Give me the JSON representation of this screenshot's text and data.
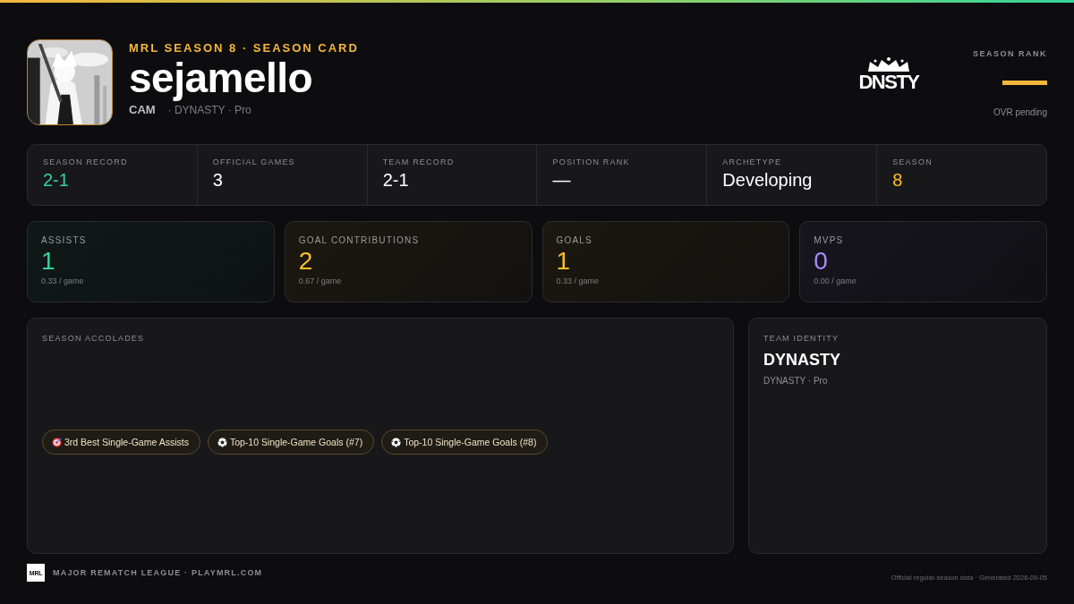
{
  "header": {
    "eyebrow": "MRL SEASON 8 · SEASON CARD",
    "player": "sejamello",
    "position": "CAM",
    "team_line": "· DYNASTY · Pro",
    "team_logo_text": "DNSTY",
    "rank_label": "SEASON RANK",
    "rank_note": "OVR pending"
  },
  "summary": [
    {
      "label": "SEASON RECORD",
      "value": "2-1",
      "color": "#34d399"
    },
    {
      "label": "OFFICIAL GAMES",
      "value": "3",
      "color": "#ffffff"
    },
    {
      "label": "TEAM RECORD",
      "value": "2-1",
      "color": "#ffffff"
    },
    {
      "label": "POSITION RANK",
      "value": "—",
      "color": "#ffffff"
    },
    {
      "label": "ARCHETYPE",
      "value": "Developing",
      "color": "#ffffff"
    },
    {
      "label": "SEASON",
      "value": "8",
      "color": "#fbbf24"
    }
  ],
  "tiles": [
    {
      "label": "ASSISTS",
      "value": "1",
      "rate": "0.33 / game",
      "color": "#34d399"
    },
    {
      "label": "GOAL CONTRIBUTIONS",
      "value": "2",
      "rate": "0.67 / game",
      "color": "#fbbf24"
    },
    {
      "label": "GOALS",
      "value": "1",
      "rate": "0.33 / game",
      "color": "#fbbf24"
    },
    {
      "label": "MVPS",
      "value": "0",
      "rate": "0.00 / game",
      "color": "#a78bfa"
    }
  ],
  "accolades": {
    "title": "SEASON ACCOLADES",
    "items": [
      {
        "kind": "target",
        "text": "3rd Best Single-Game Assists"
      },
      {
        "kind": "ball",
        "text": "Top-10 Single-Game Goals (#7)"
      },
      {
        "kind": "ball",
        "text": "Top-10 Single-Game Goals (#8)"
      }
    ]
  },
  "team_identity": {
    "title": "TEAM IDENTITY",
    "name": "DYNASTY",
    "sub": "DYNASTY · Pro"
  },
  "footer": {
    "logo_text": "MRL",
    "league": "MAJOR REMATCH LEAGUE · PLAYMRL.COM",
    "note": "Official regular-season data · Generated 2026-09-05"
  }
}
